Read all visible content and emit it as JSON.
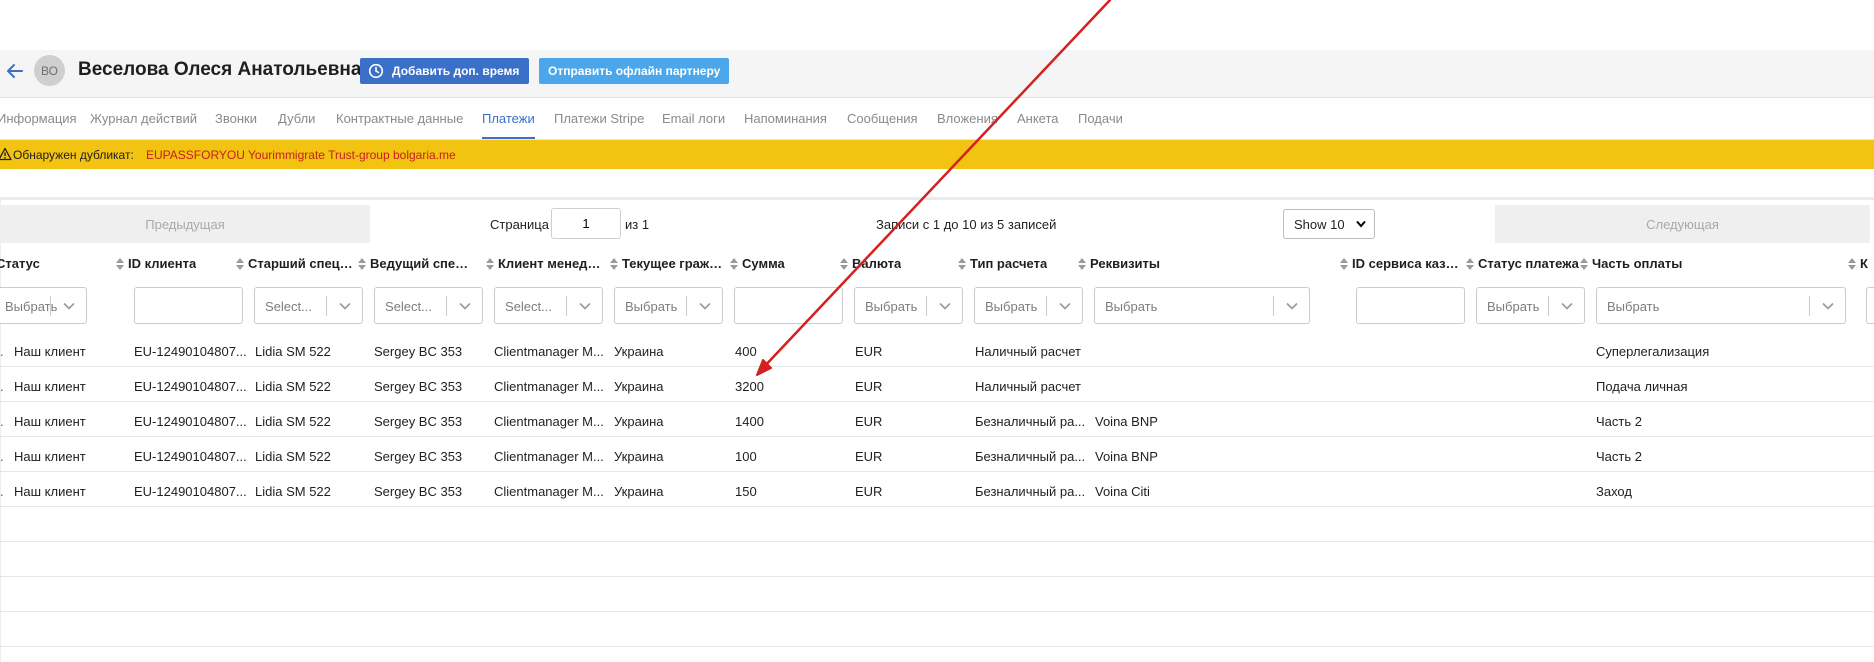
{
  "header": {
    "avatar_initials": "ВО",
    "person_name": "Веселова Олеся Анатольевна",
    "add_time_button": "Добавить доп. время",
    "send_offline_button": "Отправить офлайн партнеру"
  },
  "tabs": [
    {
      "label": "Информация"
    },
    {
      "label": "Журнал действий"
    },
    {
      "label": "Звонки"
    },
    {
      "label": "Дубли"
    },
    {
      "label": "Контрактные данные"
    },
    {
      "label": "Платежи"
    },
    {
      "label": "Платежи Stripe"
    },
    {
      "label": "Email логи"
    },
    {
      "label": "Напоминания"
    },
    {
      "label": "Сообщения"
    },
    {
      "label": "Вложения"
    },
    {
      "label": "Анкета"
    },
    {
      "label": "Подачи"
    }
  ],
  "active_tab": "Платежи",
  "banner": {
    "label": "Обнаружен дубликат:",
    "link": "EUPASSFORYOU Yourimmigrate Trust-group bolgaria.me"
  },
  "pager": {
    "prev_label": "Предыдущая",
    "page_label": "Страница",
    "page_value": "1",
    "of_label": "из 1",
    "records_label": "Записи с 1 до 10 из 5 записей",
    "show_label": "Show 10",
    "next_label": "Следующая"
  },
  "columns": [
    {
      "label": "Статус"
    },
    {
      "label": "ID клиента"
    },
    {
      "label": "Старший специалист"
    },
    {
      "label": "Ведущий специалист"
    },
    {
      "label": "Клиент менеджер"
    },
    {
      "label": "Текущее гражданство"
    },
    {
      "label": "Сумма"
    },
    {
      "label": "Валюта"
    },
    {
      "label": "Тип расчета"
    },
    {
      "label": "Реквизиты"
    },
    {
      "label": "ID сервиса казначейства"
    },
    {
      "label": "Статус платежа"
    },
    {
      "label": "Часть оплаты"
    },
    {
      "label": "К"
    }
  ],
  "filters": [
    {
      "placeholder": "Выбрать"
    },
    {
      "placeholder": ""
    },
    {
      "placeholder": "Select..."
    },
    {
      "placeholder": "Select..."
    },
    {
      "placeholder": "Select..."
    },
    {
      "placeholder": "Выбрать"
    },
    {
      "placeholder": ""
    },
    {
      "placeholder": "Выбрать"
    },
    {
      "placeholder": "Выбрать"
    },
    {
      "placeholder": "Выбрать"
    },
    {
      "placeholder": ""
    },
    {
      "placeholder": "Выбрать"
    },
    {
      "placeholder": "Выбрать"
    }
  ],
  "rows": [
    {
      "status": "Наш клиент",
      "client_id": "EU-12490104807...",
      "senior": "Lidia SM 522",
      "lead": "Sergey BC 353",
      "manager": "Clientmanager M...",
      "citizenship": "Украина",
      "amount": "400",
      "currency": "EUR",
      "payment_type": "Наличный расчет",
      "details": "",
      "part": "Суперлегализация"
    },
    {
      "status": "Наш клиент",
      "client_id": "EU-12490104807...",
      "senior": "Lidia SM 522",
      "lead": "Sergey BC 353",
      "manager": "Clientmanager M...",
      "citizenship": "Украина",
      "amount": "3200",
      "currency": "EUR",
      "payment_type": "Наличный расчет",
      "details": "",
      "part": "Подача личная"
    },
    {
      "status": "Наш клиент",
      "client_id": "EU-12490104807...",
      "senior": "Lidia SM 522",
      "lead": "Sergey BC 353",
      "manager": "Clientmanager M...",
      "citizenship": "Украина",
      "amount": "1400",
      "currency": "EUR",
      "payment_type": "Безналичный ра...",
      "details": "Voina BNP",
      "part": "Часть 2"
    },
    {
      "status": "Наш клиент",
      "client_id": "EU-12490104807...",
      "senior": "Lidia SM 522",
      "lead": "Sergey BC 353",
      "manager": "Clientmanager M...",
      "citizenship": "Украина",
      "amount": "100",
      "currency": "EUR",
      "payment_type": "Безналичный ра...",
      "details": "Voina BNP",
      "part": "Часть 2"
    },
    {
      "status": "Наш клиент",
      "client_id": "EU-12490104807...",
      "senior": "Lidia SM 522",
      "lead": "Sergey BC 353",
      "manager": "Clientmanager M...",
      "citizenship": "Украина",
      "amount": "150",
      "currency": "EUR",
      "payment_type": "Безналичный ра...",
      "details": "Voina Citi",
      "part": "Заход"
    }
  ],
  "colors": {
    "primary": "#3a70c8",
    "secondary_button": "#4ba7ea",
    "banner": "#f2c311",
    "banner_link": "#c62020",
    "annotation_arrow": "#d42020"
  },
  "icons": {
    "back": "arrow-left-icon",
    "clock": "clock-icon",
    "warning": "warning-icon",
    "sort": "sort-icon",
    "chevron": "chevron-down-icon"
  }
}
